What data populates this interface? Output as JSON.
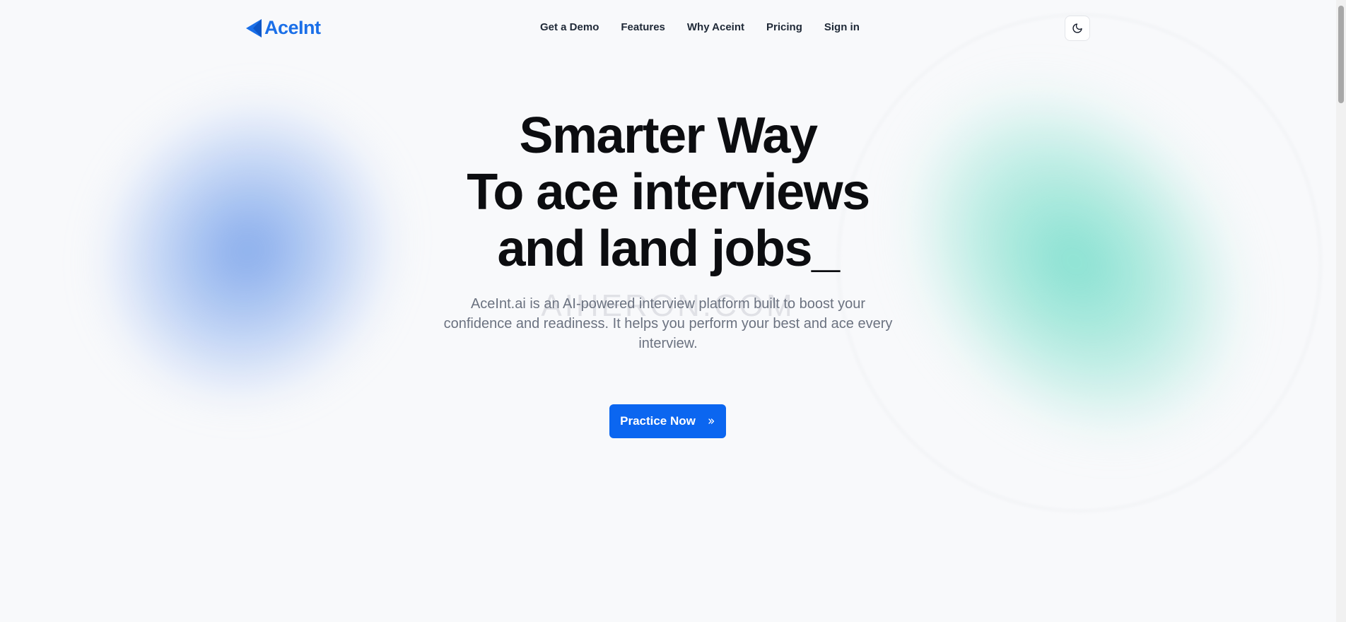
{
  "brand": {
    "name": "AceInt",
    "color": "#1a6fe8"
  },
  "nav": {
    "items": [
      {
        "label": "Get a Demo"
      },
      {
        "label": "Features"
      },
      {
        "label": "Why Aceint"
      },
      {
        "label": "Pricing"
      },
      {
        "label": "Sign in"
      }
    ]
  },
  "theme_toggle": {
    "icon": "moon-icon"
  },
  "hero": {
    "line1": "Smarter Way",
    "line2": "To ace interviews",
    "line3": "and land jobs",
    "cursor": "_",
    "subtitle": "AceInt.ai is an AI-powered interview platform built to boost your confidence and readiness. It helps you perform your best and ace every interview.",
    "watermark": "AIHERON.COM"
  },
  "cta": {
    "label": "Practice Now",
    "icon": "double-chevron-right-icon",
    "color": "#0b66f0"
  }
}
